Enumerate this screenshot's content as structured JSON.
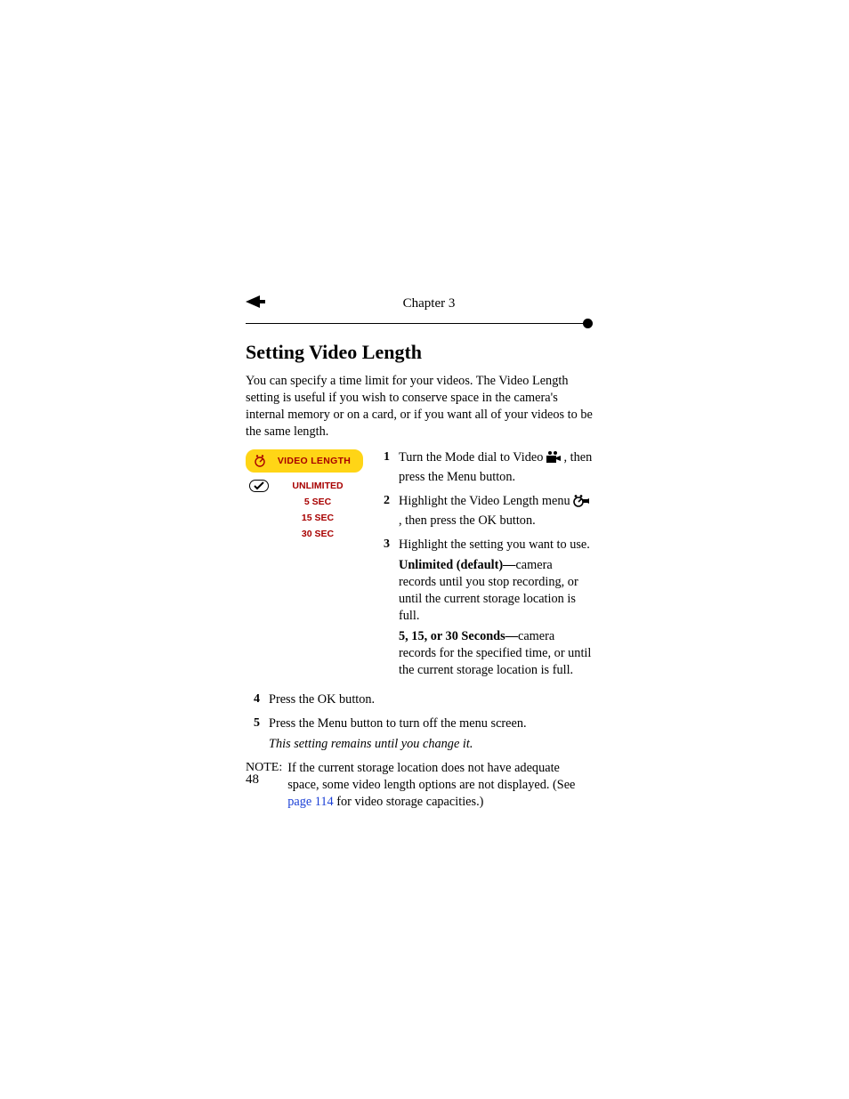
{
  "chapter": "Chapter 3",
  "heading": "Setting Video Length",
  "intro": "You can specify a time limit for your videos. The Video Length setting is useful if you wish to conserve space in the camera's internal memory or on a card, or if you want all of your videos to be the same length.",
  "figure": {
    "header": "VIDEO LENGTH",
    "items": [
      {
        "label": "UNLIMITED",
        "checked": true
      },
      {
        "label": "5 SEC",
        "checked": false
      },
      {
        "label": "15 SEC",
        "checked": false
      },
      {
        "label": "30 SEC",
        "checked": false
      }
    ]
  },
  "steps_right": [
    {
      "n": "1",
      "parts": [
        "Turn the Mode dial to Video ",
        " , then press the Menu button."
      ]
    },
    {
      "n": "2",
      "parts": [
        "Highlight the Video Length menu ",
        " , then press the OK button."
      ]
    },
    {
      "n": "3",
      "first": "Highlight the setting you want to use.",
      "unlimited_label": "Unlimited (default)—",
      "unlimited_body": "camera records until you stop recording, or until the current storage location is full.",
      "seconds_label": "5, 15, or 30 Seconds—",
      "seconds_body": "camera records for the specified time, or until the current storage location is full."
    }
  ],
  "steps_lower": [
    {
      "n": "4",
      "text": "Press the OK button."
    },
    {
      "n": "5",
      "text": "Press the Menu button to turn off the menu screen.",
      "note": "This setting remains until you change it."
    }
  ],
  "note": {
    "label": "NOTE:",
    "pre": "If the current storage location does not have adequate space, some video length options are not displayed. (See ",
    "link": "page 114",
    "post": " for video storage capacities.)"
  },
  "page_number": "48"
}
